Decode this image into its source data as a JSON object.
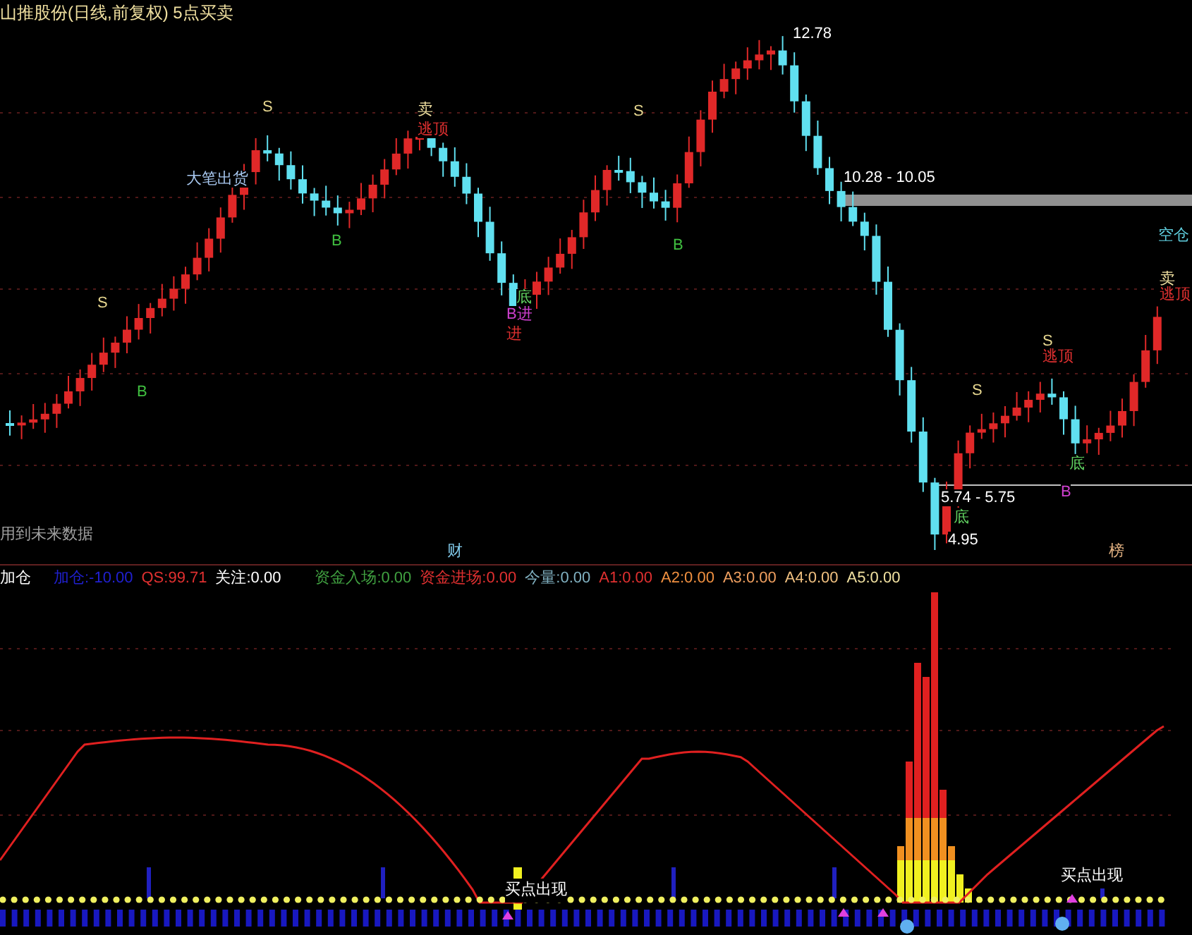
{
  "title": "山推股份(日线,前复权) 5点买卖",
  "chart_labels": [
    {
      "text": "S",
      "color": "#e8d890"
    },
    {
      "text": "卖",
      "color": "#f0e0a0"
    },
    {
      "text": "逃顶",
      "color": "#e03030"
    },
    {
      "text": "大笔出货",
      "color": "#a8c8f0"
    },
    {
      "text": "B",
      "color": "#40c040"
    },
    {
      "text": "S",
      "color": "#e8d890"
    },
    {
      "text": "B",
      "color": "#40c040"
    },
    {
      "text": "S",
      "color": "#e8d890"
    },
    {
      "text": "B",
      "color": "#40c040"
    },
    {
      "text": "底",
      "color": "#60d060"
    },
    {
      "text": "B进",
      "color": "#d040d0"
    },
    {
      "text": "进",
      "color": "#e03030"
    },
    {
      "text": "12.78",
      "color": "#ffffff"
    },
    {
      "text": "10.28 - 10.05",
      "color": "#ffffff"
    },
    {
      "text": "空仓",
      "color": "#60d0e0"
    },
    {
      "text": "卖",
      "color": "#f0e0a0"
    },
    {
      "text": "逃顶",
      "color": "#e03030"
    },
    {
      "text": "S",
      "color": "#e8d890"
    },
    {
      "text": "逃顶",
      "color": "#e03030"
    },
    {
      "text": "S",
      "color": "#e8d890"
    },
    {
      "text": "底",
      "color": "#60d060"
    },
    {
      "text": "B",
      "color": "#d040d0"
    },
    {
      "text": "5.74 - 5.75",
      "color": "#ffffff"
    },
    {
      "text": "底",
      "color": "#60d060"
    },
    {
      "text": "4.95",
      "color": "#ffffff"
    },
    {
      "text": "用到未来数据",
      "color": "#a0a0a0"
    },
    {
      "text": "财",
      "color": "#80c8e8"
    },
    {
      "text": "榜",
      "color": "#e0b080"
    }
  ],
  "indicator": {
    "name": "加仓",
    "values": [
      {
        "text": "加仓:-10.00",
        "color": "#2020d0"
      },
      {
        "text": "QS:99.71",
        "color": "#e03030"
      },
      {
        "text": "关注:0.00",
        "color": "#ffffff"
      },
      {
        "text": "资金入场:0.00",
        "color": "#40a040"
      },
      {
        "text": "资金进场:0.00",
        "color": "#e03030"
      },
      {
        "text": "今量:0.00",
        "color": "#80b0c0"
      },
      {
        "text": "A1:0.00",
        "color": "#e03030"
      },
      {
        "text": "A2:0.00",
        "color": "#f09040"
      },
      {
        "text": "A3:0.00",
        "color": "#f0a060"
      },
      {
        "text": "A4:0.00",
        "color": "#f0c080"
      },
      {
        "text": "A5:0.00",
        "color": "#f0e0a0"
      }
    ]
  },
  "indicator_labels": [
    {
      "text": "买点出现"
    },
    {
      "text": "买点出现"
    }
  ]
}
